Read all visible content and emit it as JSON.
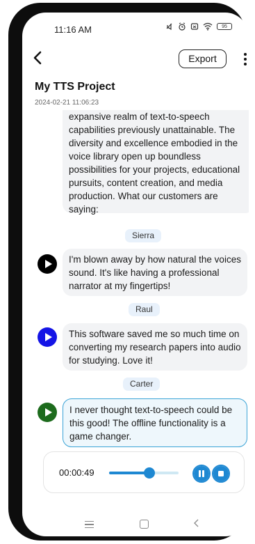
{
  "status_bar": {
    "time": "11:16 AM",
    "battery": "95"
  },
  "toolbar": {
    "export_label": "Export"
  },
  "project": {
    "title": "My TTS Project",
    "date": "2024-02-21 11:06:23"
  },
  "messages": [
    {
      "speaker": "",
      "text": "expansive realm of text-to-speech capabilities previously unattainable. The diversity and excellence embodied in the voice library open up boundless possibilities for your projects, educational pursuits, content creation, and media production. What our customers are saying:"
    },
    {
      "speaker": "Sierra",
      "text": "I'm blown away by how natural the voices sound. It's like having a professional narrator at my fingertips!",
      "color": "#000000"
    },
    {
      "speaker": "Raul",
      "text": "This software saved me so much time on converting my research papers into audio for studying. Love it!",
      "color": "#1414e6"
    },
    {
      "speaker": "Carter",
      "text": "I never thought text-to-speech could be this good! The offline functionality is a game changer.",
      "color": "#1d6b1d"
    }
  ],
  "player": {
    "elapsed": "00:00:49",
    "progress": 0.58,
    "accent": "#1e88d2"
  }
}
